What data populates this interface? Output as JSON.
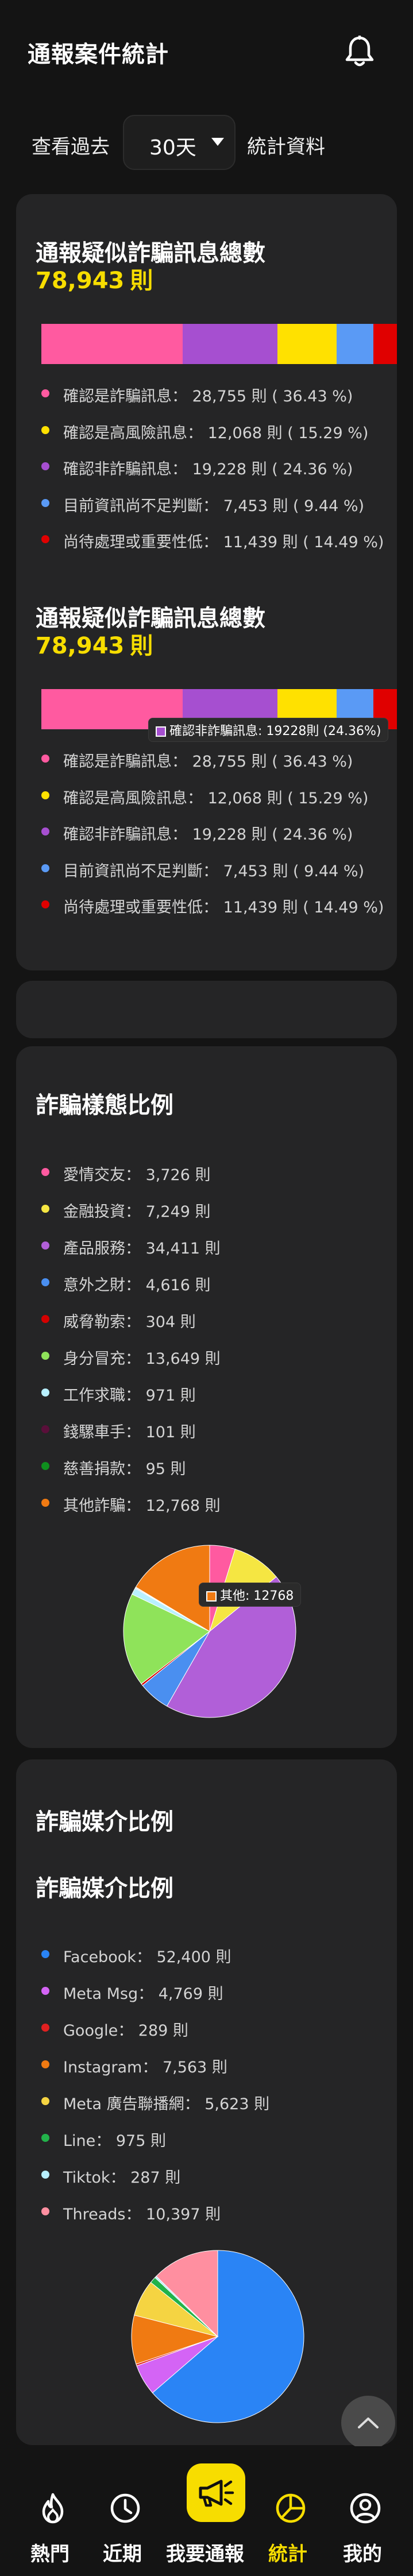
{
  "header": {
    "title": "通報案件統計",
    "bell_icon": "bell-icon"
  },
  "filter": {
    "prefix": "查看過去",
    "period": "30天",
    "suffix": "統計資料"
  },
  "colors": {
    "accent": "#f7dd00",
    "pink": "#ff5aa0",
    "purple": "#a64fd0",
    "yellow": "#ffe100",
    "blue": "#5a9af5",
    "red": "#e00000"
  },
  "total_card_1": {
    "title": "通報疑似詐騙訊息總數",
    "total": "78,943",
    "unit": "則",
    "legend": [
      {
        "label": "確認是詐騙訊息",
        "value": "28,755",
        "pct": "36.43",
        "color": "#ff5aa0"
      },
      {
        "label": "確認是高風險訊息",
        "value": "12,068",
        "pct": "15.29",
        "color": "#ffe100"
      },
      {
        "label": "確認非詐騙訊息",
        "value": "19,228",
        "pct": "24.36",
        "color": "#a64fd0"
      },
      {
        "label": "目前資訊尚不足判斷",
        "value": "7,453",
        "pct": "9.44",
        "color": "#5a9af5"
      },
      {
        "label": "尚待處理或重要性低",
        "value": "11,439",
        "pct": "14.49",
        "color": "#e00000"
      }
    ]
  },
  "total_card_2": {
    "title": "通報疑似詐騙訊息總數",
    "total": "78,943",
    "unit": "則",
    "tooltip": "確認非詐騙訊息: 19228則 (24.36%)",
    "legend": [
      {
        "label": "確認是詐騙訊息",
        "value": "28,755",
        "pct": "36.43",
        "color": "#ff5aa0"
      },
      {
        "label": "確認是高風險訊息",
        "value": "12,068",
        "pct": "15.29",
        "color": "#ffe100"
      },
      {
        "label": "確認非詐騙訊息",
        "value": "19,228",
        "pct": "24.36",
        "color": "#a64fd0"
      },
      {
        "label": "目前資訊尚不足判斷",
        "value": "7,453",
        "pct": "9.44",
        "color": "#5a9af5"
      },
      {
        "label": "尚待處理或重要性低",
        "value": "11,439",
        "pct": "14.49",
        "color": "#e00000"
      }
    ]
  },
  "stack_bar_segments": [
    {
      "label": "確認是詐騙訊息",
      "value": 28755,
      "color": "#ff5aa0"
    },
    {
      "label": "確認非詐騙訊息",
      "value": 19228,
      "color": "#a64fd0"
    },
    {
      "label": "確認是高風險訊息",
      "value": 12068,
      "color": "#ffe100"
    },
    {
      "label": "目前資訊尚不足判斷",
      "value": 7453,
      "color": "#5a9af5"
    },
    {
      "label": "尚待處理或重要性低",
      "value": 11439,
      "color": "#e00000"
    }
  ],
  "pattern_card": {
    "title": "詐騙樣態比例",
    "tooltip": "其他: 12768",
    "legend": [
      {
        "label": "愛情交友",
        "value": "3,726",
        "color": "#ff5aa0"
      },
      {
        "label": "金融投資",
        "value": "7,249",
        "color": "#f5e642"
      },
      {
        "label": "產品服務",
        "value": "34,411",
        "color": "#b15fd8"
      },
      {
        "label": "意外之財",
        "value": "4,616",
        "color": "#4a8ff0"
      },
      {
        "label": "威脅勒索",
        "value": "304",
        "color": "#d40000"
      },
      {
        "label": "身分冒充",
        "value": "13,649",
        "color": "#8fe35a"
      },
      {
        "label": "工作求職",
        "value": "971",
        "color": "#b8f0ff"
      },
      {
        "label": "錢騾車手",
        "value": "101",
        "color": "#5a0f3a"
      },
      {
        "label": "慈善捐款",
        "value": "95",
        "color": "#0f8f1e"
      },
      {
        "label": "其他詐騙",
        "value": "12,768",
        "color": "#f07a12"
      }
    ]
  },
  "media_card": {
    "title": "詐騙媒介比例",
    "subtitle": "詐騙媒介比例",
    "legend": [
      {
        "label": "Facebook",
        "value": "52,400",
        "color": "#2a84f5"
      },
      {
        "label": "Meta Msg",
        "value": "4,769",
        "color": "#d464f5"
      },
      {
        "label": "Google",
        "value": "289",
        "color": "#e02020"
      },
      {
        "label": "Instagram",
        "value": "7,563",
        "color": "#f07a12"
      },
      {
        "label": "Meta 廣告聯播網",
        "value": "5,623",
        "color": "#f5d442"
      },
      {
        "label": "Line",
        "value": "975",
        "color": "#22b24a"
      },
      {
        "label": "Tiktok",
        "value": "287",
        "color": "#b8f0ff"
      },
      {
        "label": "Threads",
        "value": "10,397",
        "color": "#ff8fa0"
      }
    ]
  },
  "chart_data": [
    {
      "type": "bar",
      "title": "通報疑似詐騙訊息總數",
      "categories": [
        "確認是詐騙訊息",
        "確認非詐騙訊息",
        "確認是高風險訊息",
        "目前資訊尚不足判斷",
        "尚待處理或重要性低"
      ],
      "values": [
        28755,
        19228,
        12068,
        7453,
        11439
      ]
    },
    {
      "type": "pie",
      "title": "詐騙樣態比例",
      "categories": [
        "愛情交友",
        "金融投資",
        "產品服務",
        "意外之財",
        "威脅勒索",
        "身分冒充",
        "工作求職",
        "錢騾車手",
        "慈善捐款",
        "其他詐騙"
      ],
      "values": [
        3726,
        7249,
        34411,
        4616,
        304,
        13649,
        971,
        101,
        95,
        12768
      ]
    },
    {
      "type": "pie",
      "title": "詐騙媒介比例",
      "categories": [
        "Facebook",
        "Meta Msg",
        "Google",
        "Instagram",
        "Meta 廣告聯播網",
        "Line",
        "Tiktok",
        "Threads"
      ],
      "values": [
        52400,
        4769,
        289,
        7563,
        5623,
        975,
        287,
        10397
      ]
    }
  ],
  "scroll_top_icon": "chevron-up-icon",
  "nav": {
    "items": [
      {
        "label": "熱門",
        "icon": "flame-icon"
      },
      {
        "label": "近期",
        "icon": "clock-icon"
      },
      {
        "label": "我要通報",
        "icon": "megaphone-icon"
      },
      {
        "label": "統計",
        "icon": "pie-chart-icon"
      },
      {
        "label": "我的",
        "icon": "user-icon"
      }
    ]
  }
}
